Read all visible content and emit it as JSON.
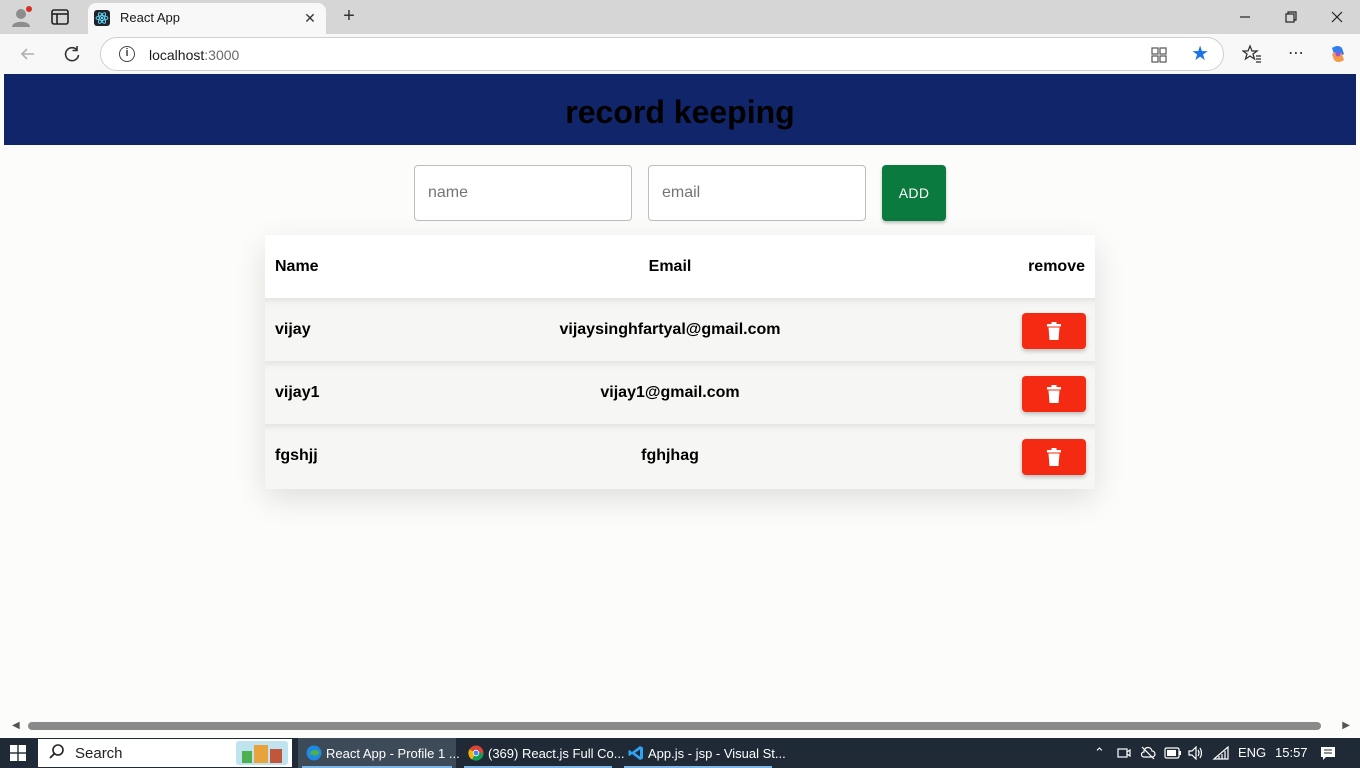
{
  "browser": {
    "tab_title": "React App",
    "url_host": "localhost",
    "url_port": ":3000",
    "close_tab": "✕",
    "new_tab": "+"
  },
  "page": {
    "heading": "record keeping",
    "form": {
      "name_placeholder": "name",
      "email_placeholder": "email",
      "add_label": "ADD"
    },
    "table": {
      "headers": [
        "Name",
        "Email",
        "remove"
      ],
      "rows": [
        {
          "name": "vijay",
          "email": "vijaysinghfartyal@gmail.com"
        },
        {
          "name": "vijay1",
          "email": "vijay1@gmail.com"
        },
        {
          "name": "fgshjj",
          "email": "fghjhag"
        }
      ]
    },
    "colors": {
      "header_bg": "#10256a",
      "add_button": "#0b7a3e",
      "delete_button": "#f42a12"
    }
  },
  "taskbar": {
    "search_label": "Search",
    "apps": [
      {
        "label": "React App - Profile 1 ...",
        "icon": "edge-icon"
      },
      {
        "label": "(369) React.js Full Co...",
        "icon": "chrome-icon"
      },
      {
        "label": "App.js - jsp - Visual St...",
        "icon": "vscode-icon"
      }
    ],
    "language": "ENG",
    "time": "15:57"
  }
}
